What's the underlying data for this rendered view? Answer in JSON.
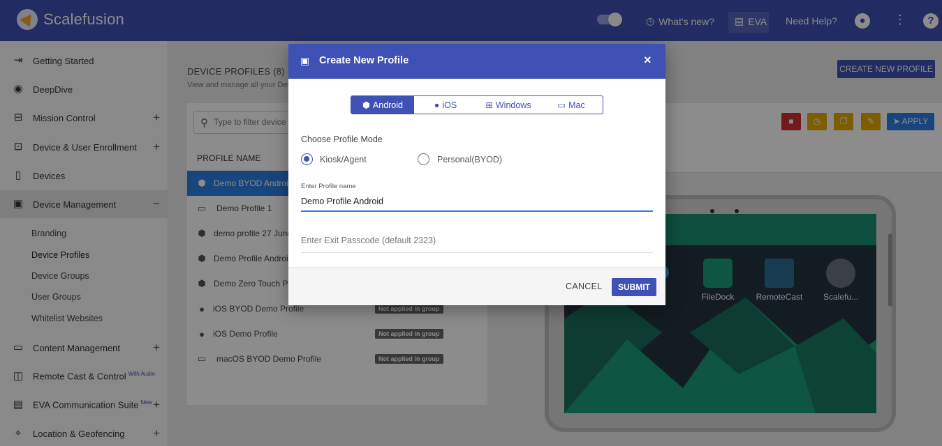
{
  "app": {
    "name": "Scalefusion"
  },
  "topbar": {
    "whats_new": "What's new?",
    "eva": "EVA",
    "need_help": "Need Help?",
    "help_glyph": "?"
  },
  "sidebar": {
    "items": [
      {
        "label": "Getting Started",
        "icon": "enter-icon",
        "glyph": "⇥",
        "expand": ""
      },
      {
        "label": "DeepDive",
        "icon": "gauge-icon",
        "glyph": "◉",
        "expand": ""
      },
      {
        "label": "Mission Control",
        "icon": "console-icon",
        "glyph": "⊟",
        "expand": "+"
      },
      {
        "label": "Device & User Enrollment",
        "icon": "devices-icon",
        "glyph": "⊡",
        "expand": "+"
      },
      {
        "label": "Devices",
        "icon": "phone-icon",
        "glyph": "▯",
        "expand": ""
      },
      {
        "label": "Device Management",
        "icon": "briefcase-icon",
        "glyph": "▣",
        "expand": "−"
      }
    ],
    "subitems": [
      "Branding",
      "Device Profiles",
      "Device Groups",
      "User Groups",
      "Whitelist Websites"
    ],
    "items_bottom": [
      {
        "label": "Content Management",
        "sup": "",
        "icon": "folder-icon",
        "glyph": "▭",
        "expand": "+"
      },
      {
        "label": "Remote Cast & Control",
        "sup": "With Audio",
        "icon": "cast-icon",
        "glyph": "◫",
        "expand": ""
      },
      {
        "label": "EVA Communication Suite",
        "sup": "New",
        "icon": "chat-icon",
        "glyph": "▤",
        "expand": "+"
      },
      {
        "label": "Location & Geofencing",
        "sup": "",
        "icon": "map-icon",
        "glyph": "⌖",
        "expand": "+"
      }
    ]
  },
  "main": {
    "title": "DEVICE PROFILES (8)",
    "subtitle": "View and manage all your Dev",
    "create_button": "CREATE NEW PROFILE",
    "search_placeholder": "Type to filter device pro",
    "column_header": "PROFILE NAME",
    "apply": "APPLY",
    "profiles": [
      {
        "name": "Demo BYOD Android",
        "os": "android",
        "badge": ""
      },
      {
        "name": "Demo Profile 1",
        "os": "laptop",
        "badge": ""
      },
      {
        "name": "demo profile 27 June",
        "os": "android",
        "badge": ""
      },
      {
        "name": "Demo Profile Android",
        "os": "android",
        "badge": ""
      },
      {
        "name": "Demo Zero Touch Pr",
        "os": "android",
        "badge": ""
      },
      {
        "name": "iOS BYOD Demo Profile",
        "os": "apple",
        "badge": "Not applied in group"
      },
      {
        "name": "iOS Demo Profile",
        "os": "apple",
        "badge": "Not applied in group"
      },
      {
        "name": "macOS BYOD Demo Profile",
        "os": "laptop",
        "badge": "Not applied in group"
      }
    ],
    "preview_apps": [
      "FileDock",
      "RemoteCast",
      "Scalefu..."
    ]
  },
  "modal": {
    "title": "Create New Profile",
    "close": "×",
    "platforms": [
      "Android",
      "iOS",
      "Windows",
      "Mac"
    ],
    "selected_platform": "Android",
    "mode_label": "Choose Profile Mode",
    "modes": [
      "Kiosk/Agent",
      "Personal(BYOD)"
    ],
    "selected_mode": "Kiosk/Agent",
    "name_label": "Enter Profile name",
    "name_value": "Demo Profile Android",
    "passcode_placeholder": "Enter Exit Passcode (default 2323)",
    "cancel": "CANCEL",
    "submit": "SUBMIT"
  },
  "colors": {
    "primary": "#3f51b5",
    "selected_row": "#2f7ee5",
    "delete": "#d32f2f",
    "warn": "#e6a800",
    "screen_accent": "#1a8e72"
  }
}
